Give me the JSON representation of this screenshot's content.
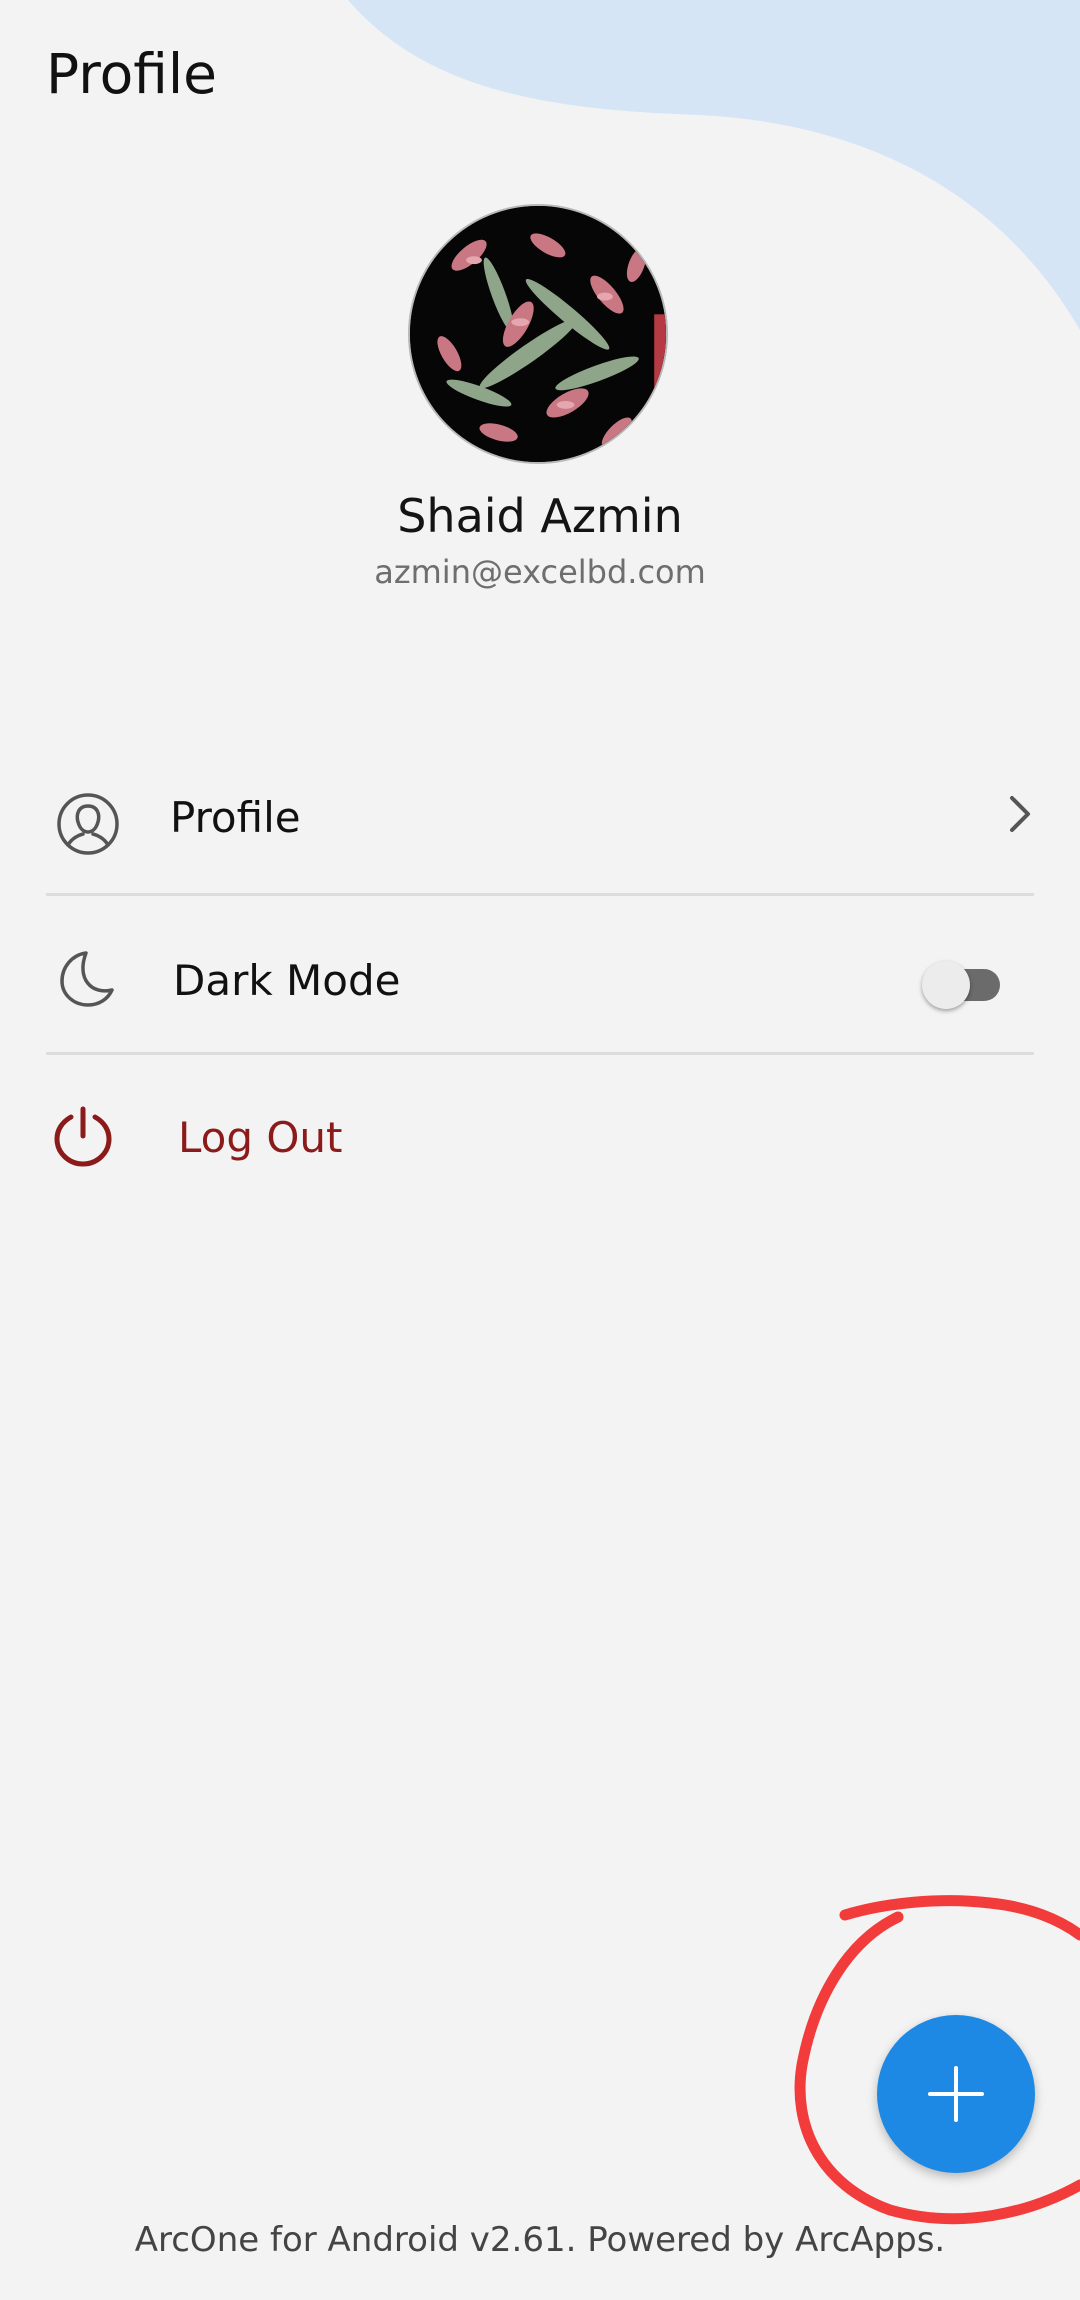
{
  "header": {
    "title": "Profile"
  },
  "user": {
    "name": "Shaid Azmin",
    "email": "azmin@excelbd.com"
  },
  "menu": {
    "profile": {
      "label": "Profile",
      "icon": "user-icon"
    },
    "dark_mode": {
      "label": "Dark Mode",
      "icon": "moon-icon",
      "enabled": false
    },
    "logout": {
      "label": "Log Out",
      "icon": "power-icon"
    }
  },
  "fab": {
    "icon": "plus-icon"
  },
  "footer": {
    "text": "ArcOne for Android v2.61. Powered by ArcApps."
  },
  "colors": {
    "background": "#f3f3f3",
    "wave": "#d5e5f5",
    "fab": "#1e88e5",
    "logout": "#8b1a1a",
    "annotation": "#f23b3b"
  }
}
